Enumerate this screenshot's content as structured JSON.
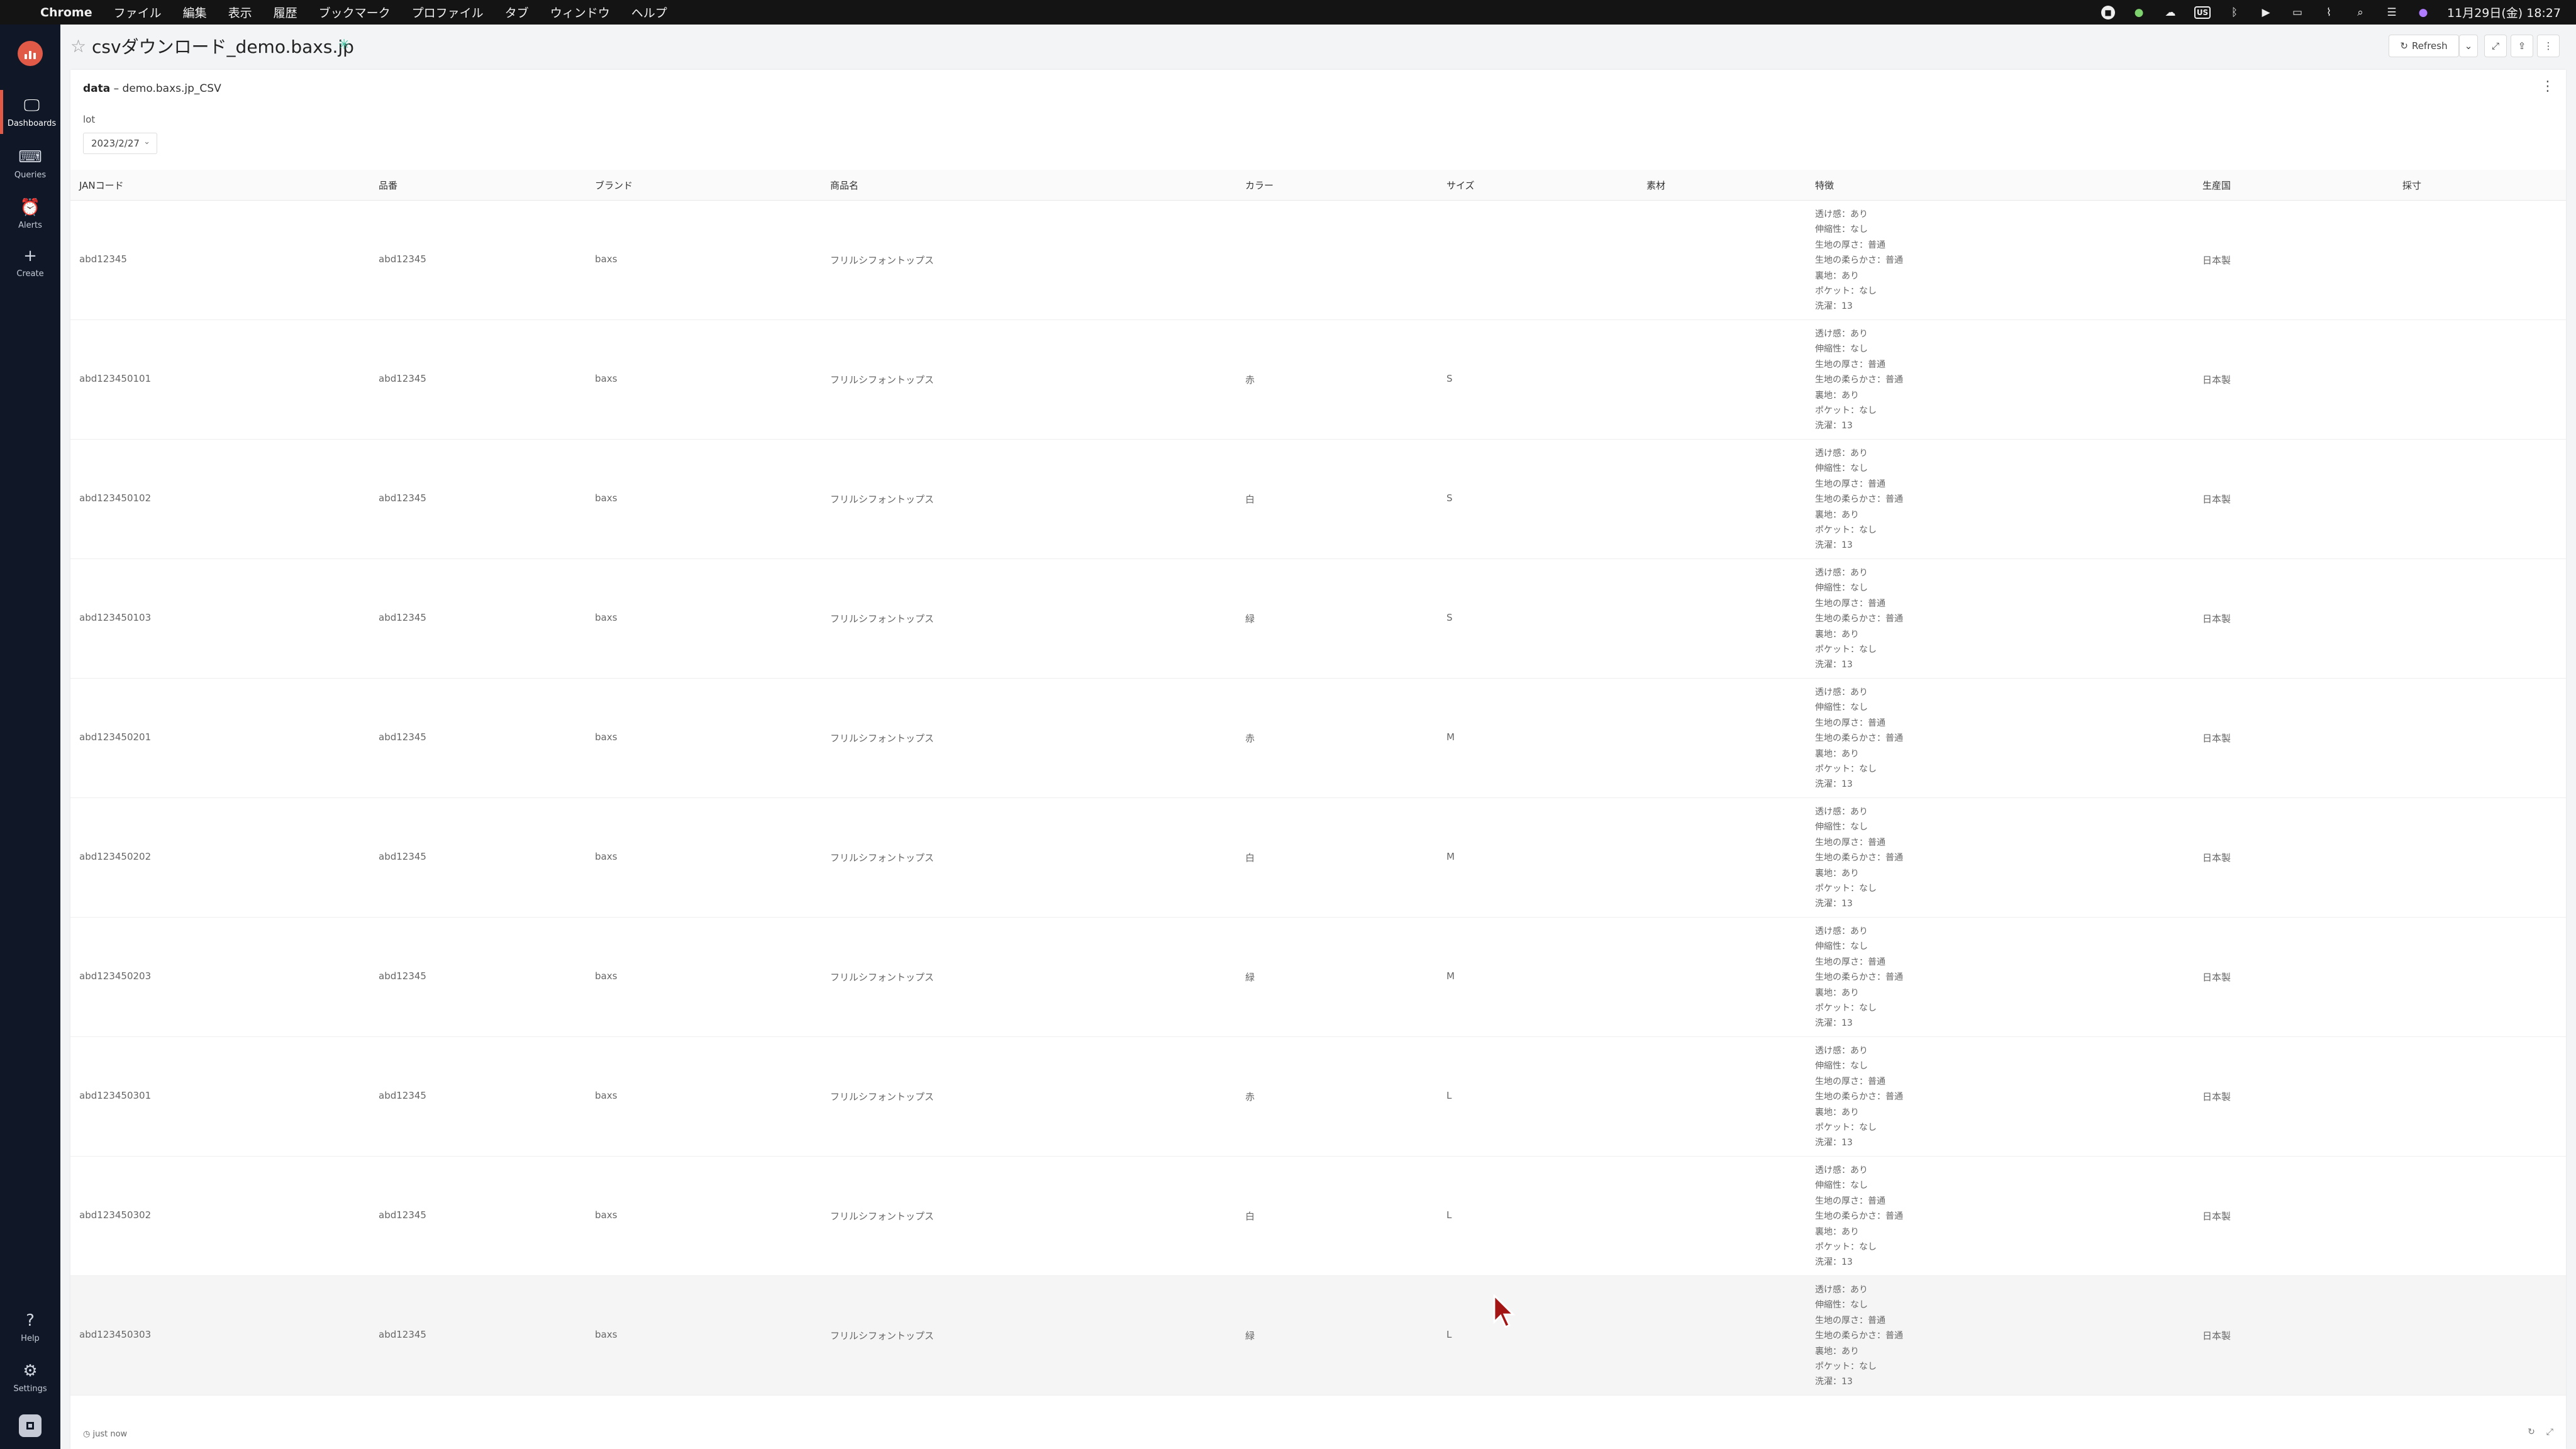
{
  "menubar": {
    "app_name": "Chrome",
    "items": [
      "ファイル",
      "編集",
      "表示",
      "履歴",
      "ブックマーク",
      "プロファイル",
      "タブ",
      "ウィンドウ",
      "ヘルプ"
    ],
    "input_source": "US",
    "clock": "11月29日(金) 18:27"
  },
  "sidenav": {
    "items": [
      {
        "label": "Dashboards",
        "icon": "monitor-icon"
      },
      {
        "label": "Queries",
        "icon": "terminal-icon"
      },
      {
        "label": "Alerts",
        "icon": "bell-icon"
      },
      {
        "label": "Create",
        "icon": "plus-icon"
      }
    ],
    "bottom": [
      {
        "label": "Help",
        "icon": "help-circle-icon"
      },
      {
        "label": "Settings",
        "icon": "gear-icon"
      }
    ]
  },
  "dashboard": {
    "title": "csvダウンロード_demo.baxs.jp",
    "refresh_label": "Refresh"
  },
  "widget": {
    "title_bold": "data",
    "title_rest": " – demo.baxs.jp_CSV",
    "param_label": "lot",
    "param_value": "2023/2/27",
    "footer_time": "just now",
    "columns": [
      "JANコード",
      "品番",
      "ブランド",
      "商品名",
      "カラー",
      "サイズ",
      "素材",
      "特徴",
      "生産国",
      "採寸"
    ],
    "rows": [
      {
        "jan": "abd12345",
        "hinban": "abd12345",
        "brand": "baxs",
        "name": "フリルシフォントップス",
        "color": "",
        "size": "",
        "material": "",
        "country": "日本製",
        "measure": ""
      },
      {
        "jan": "abd123450101",
        "hinban": "abd12345",
        "brand": "baxs",
        "name": "フリルシフォントップス",
        "color": "赤",
        "size": "S",
        "material": "",
        "country": "日本製",
        "measure": ""
      },
      {
        "jan": "abd123450102",
        "hinban": "abd12345",
        "brand": "baxs",
        "name": "フリルシフォントップス",
        "color": "白",
        "size": "S",
        "material": "",
        "country": "日本製",
        "measure": ""
      },
      {
        "jan": "abd123450103",
        "hinban": "abd12345",
        "brand": "baxs",
        "name": "フリルシフォントップス",
        "color": "緑",
        "size": "S",
        "material": "",
        "country": "日本製",
        "measure": ""
      },
      {
        "jan": "abd123450201",
        "hinban": "abd12345",
        "brand": "baxs",
        "name": "フリルシフォントップス",
        "color": "赤",
        "size": "M",
        "material": "",
        "country": "日本製",
        "measure": ""
      },
      {
        "jan": "abd123450202",
        "hinban": "abd12345",
        "brand": "baxs",
        "name": "フリルシフォントップス",
        "color": "白",
        "size": "M",
        "material": "",
        "country": "日本製",
        "measure": ""
      },
      {
        "jan": "abd123450203",
        "hinban": "abd12345",
        "brand": "baxs",
        "name": "フリルシフォントップス",
        "color": "緑",
        "size": "M",
        "material": "",
        "country": "日本製",
        "measure": ""
      },
      {
        "jan": "abd123450301",
        "hinban": "abd12345",
        "brand": "baxs",
        "name": "フリルシフォントップス",
        "color": "赤",
        "size": "L",
        "material": "",
        "country": "日本製",
        "measure": ""
      },
      {
        "jan": "abd123450302",
        "hinban": "abd12345",
        "brand": "baxs",
        "name": "フリルシフォントップス",
        "color": "白",
        "size": "L",
        "material": "",
        "country": "日本製",
        "measure": ""
      },
      {
        "jan": "abd123450303",
        "hinban": "abd12345",
        "brand": "baxs",
        "name": "フリルシフォントップス",
        "color": "緑",
        "size": "L",
        "material": "",
        "country": "日本製",
        "measure": ""
      }
    ],
    "features": [
      "透け感：あり",
      "伸縮性：なし",
      "生地の厚さ：普通",
      "生地の柔らかさ：普通",
      "裏地：あり",
      "ポケット：なし",
      "洗濯：13"
    ]
  },
  "colors": {
    "accent": "#e05a47",
    "nav_bg": "#101828",
    "menubar_bg": "#141414",
    "published": "#49c7a8",
    "cursor": "#a31515"
  }
}
